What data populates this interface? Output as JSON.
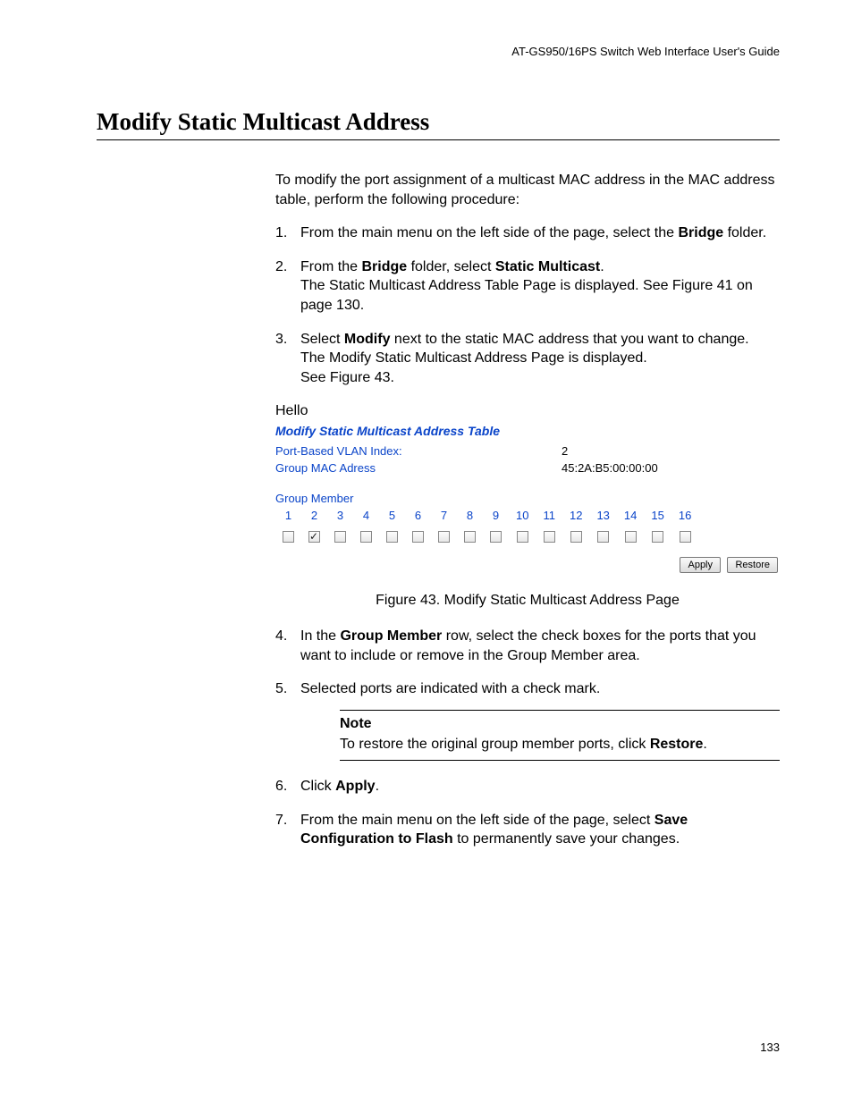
{
  "header": {
    "running_head": "AT-GS950/16PS Switch Web Interface User's Guide"
  },
  "section": {
    "title": "Modify Static Multicast Address",
    "intro": "To modify the port assignment of a multicast MAC address in the MAC address table, perform the following procedure:"
  },
  "steps": {
    "s1_a": "From the main menu on the left side of the page, select the ",
    "s1_b": "Bridge",
    "s1_c": " folder.",
    "s2_a": "From the ",
    "s2_b": "Bridge",
    "s2_c": " folder, select ",
    "s2_d": "Static Multicast",
    "s2_e": ".",
    "s2_line2": "The Static Multicast Address Table Page is displayed. See Figure 41 on page 130.",
    "s3_a": "Select ",
    "s3_b": "Modify",
    "s3_c": " next to the static MAC address that you want to change.",
    "s3_line2": "The Modify Static Multicast Address Page is displayed.",
    "s3_line3": "See Figure 43.",
    "s4_a": "In the ",
    "s4_b": "Group Member",
    "s4_c": " row, select the check boxes for the ports that you want to include or remove in the Group Member area.",
    "s5": "Selected ports are indicated with a check mark.",
    "s6_a": "Click ",
    "s6_b": "Apply",
    "s6_c": ".",
    "s7_a": "From the main menu on the left side of the page, select ",
    "s7_b": "Save Configuration to Flash",
    "s7_c": " to permanently save your changes."
  },
  "hello": "Hello",
  "figure": {
    "panel_title": "Modify Static Multicast Address Table",
    "vlan_label": "Port-Based VLAN Index:",
    "vlan_value": "2",
    "mac_label": "Group MAC Adress",
    "mac_value": "45:2A:B5:00:00:00",
    "group_member_label": "Group Member",
    "ports": [
      "1",
      "2",
      "3",
      "4",
      "5",
      "6",
      "7",
      "8",
      "9",
      "10",
      "11",
      "12",
      "13",
      "14",
      "15",
      "16"
    ],
    "checked": [
      false,
      true,
      false,
      false,
      false,
      false,
      false,
      false,
      false,
      false,
      false,
      false,
      false,
      false,
      false,
      false
    ],
    "apply_label": "Apply",
    "restore_label": "Restore",
    "caption": "Figure 43. Modify Static Multicast Address Page"
  },
  "note": {
    "label": "Note",
    "text_a": "To restore the original group member ports, click ",
    "text_b": "Restore",
    "text_c": "."
  },
  "page_number": "133"
}
